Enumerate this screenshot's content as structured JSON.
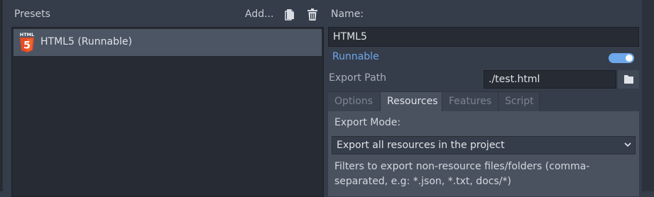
{
  "presets_panel": {
    "label": "Presets",
    "add_label": "Add...",
    "items": [
      {
        "label": "HTML5 (Runnable)",
        "icon": "html5-icon",
        "badge_text": "HTML",
        "badge_glyph": "5"
      }
    ]
  },
  "preset_settings": {
    "name_label": "Name:",
    "name_value": "HTML5",
    "runnable_label": "Runnable",
    "runnable_on": true,
    "export_path_label": "Export Path",
    "export_path_value": "./test.html",
    "tabs": [
      {
        "label": "Options",
        "active": false
      },
      {
        "label": "Resources",
        "active": true
      },
      {
        "label": "Features",
        "active": false
      },
      {
        "label": "Script",
        "active": false
      }
    ],
    "resources": {
      "export_mode_label": "Export Mode:",
      "export_mode_value": "Export all resources in the project",
      "filters_label": "Filters to export non-resource files/folders (comma-separated, e.g: *.json, *.txt, docs/*)"
    }
  },
  "colors": {
    "accent": "#6da8ea",
    "html5_orange": "#e44d26",
    "selection": "#4c5563"
  }
}
